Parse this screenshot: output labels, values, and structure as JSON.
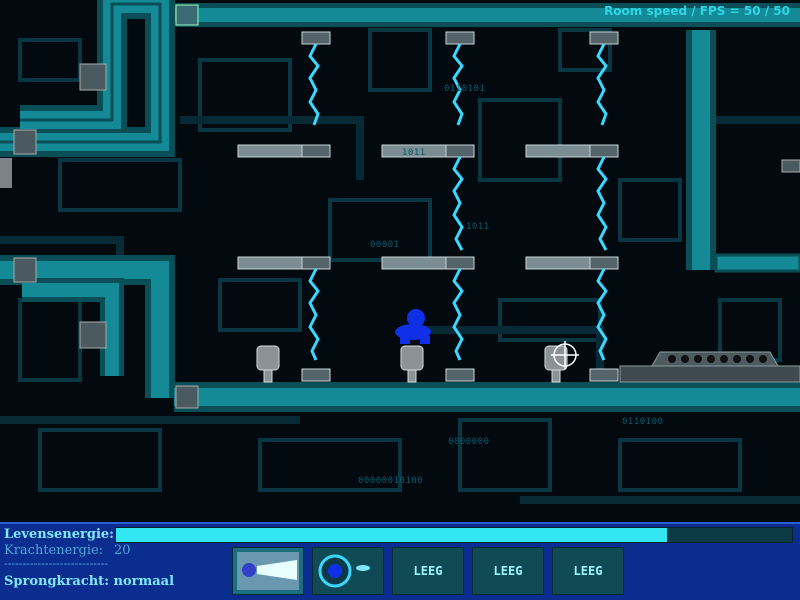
{
  "status": {
    "fps_text": "Room speed / FPS = 50 / 50"
  },
  "background_binary": [
    "0110101",
    "00001",
    "1011",
    "1011",
    "0000000",
    "0110100",
    "00000010100"
  ],
  "hud": {
    "life_label": "Levensenergie:",
    "life_fraction": 0.815,
    "power_label": "Krachtenergie:",
    "power_value": "20",
    "separator": "----------------------------",
    "jump_label": "Sprongkracht: normaal",
    "slots": [
      {
        "icon": "laser-beam-icon",
        "label": ""
      },
      {
        "icon": "shield-orb-icon",
        "label": ""
      },
      {
        "icon": "",
        "label": "LEEG"
      },
      {
        "icon": "",
        "label": "LEEG"
      },
      {
        "icon": "",
        "label": "LEEG"
      }
    ]
  },
  "colors": {
    "pipe_teal": "#138a96",
    "pipe_dark": "#0a4f58",
    "electric": "#3ad8ff",
    "player_blue": "#1030e8",
    "hud_blue": "#0a2d8f",
    "lifebar_fill": "#32e6f2"
  }
}
